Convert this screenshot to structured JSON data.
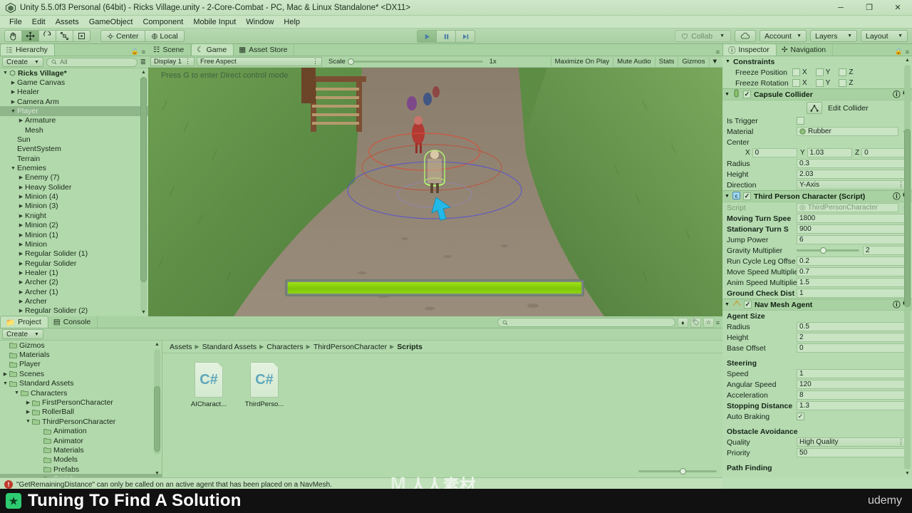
{
  "window": {
    "title": "Unity 5.5.0f3 Personal (64bit) - Ricks Village.unity - 2-Core-Combat - PC, Mac & Linux Standalone* <DX11>",
    "minimize": "─",
    "maximize": "❐",
    "close": "✕"
  },
  "menu": [
    "File",
    "Edit",
    "Assets",
    "GameObject",
    "Component",
    "Mobile Input",
    "Window",
    "Help"
  ],
  "toolbar": {
    "tools": [
      "hand-tool",
      "move-tool",
      "rotate-tool",
      "scale-tool",
      "rect-tool"
    ],
    "pivot": "Center",
    "space": "Local",
    "play": "▶",
    "pause": "❚❚",
    "step": "▶|",
    "collab": "Collab",
    "cloud": "cloud-icon",
    "account": "Account",
    "layers": "Layers",
    "layout": "Layout"
  },
  "hierarchy": {
    "tab": "Hierarchy",
    "create": "Create",
    "search_placeholder": "All",
    "root": "Ricks Village*",
    "items": [
      {
        "label": "Game Canvas",
        "depth": 1,
        "arrow": "▶"
      },
      {
        "label": "Healer",
        "depth": 1,
        "arrow": "▶"
      },
      {
        "label": "Camera Arm",
        "depth": 1,
        "arrow": "▶"
      },
      {
        "label": "Player",
        "depth": 1,
        "arrow": "▼",
        "selected": true
      },
      {
        "label": "Armature",
        "depth": 2,
        "arrow": "▶"
      },
      {
        "label": "Mesh",
        "depth": 2,
        "arrow": ""
      },
      {
        "label": "Sun",
        "depth": 1,
        "arrow": ""
      },
      {
        "label": "EventSystem",
        "depth": 1,
        "arrow": ""
      },
      {
        "label": "Terrain",
        "depth": 1,
        "arrow": ""
      },
      {
        "label": "Enemies",
        "depth": 1,
        "arrow": "▼"
      },
      {
        "label": "Enemy (7)",
        "depth": 2,
        "arrow": "▶"
      },
      {
        "label": "Heavy Solider",
        "depth": 2,
        "arrow": "▶"
      },
      {
        "label": "Minion (4)",
        "depth": 2,
        "arrow": "▶"
      },
      {
        "label": "Minion (3)",
        "depth": 2,
        "arrow": "▶"
      },
      {
        "label": "Knight",
        "depth": 2,
        "arrow": "▶"
      },
      {
        "label": "Minion (2)",
        "depth": 2,
        "arrow": "▶"
      },
      {
        "label": "Minion (1)",
        "depth": 2,
        "arrow": "▶"
      },
      {
        "label": "Minion",
        "depth": 2,
        "arrow": "▶"
      },
      {
        "label": "Regular Solider (1)",
        "depth": 2,
        "arrow": "▶"
      },
      {
        "label": "Regular Solider",
        "depth": 2,
        "arrow": "▶"
      },
      {
        "label": "Healer (1)",
        "depth": 2,
        "arrow": "▶"
      },
      {
        "label": "Archer (2)",
        "depth": 2,
        "arrow": "▶"
      },
      {
        "label": "Archer (1)",
        "depth": 2,
        "arrow": "▶"
      },
      {
        "label": "Archer",
        "depth": 2,
        "arrow": "▶"
      },
      {
        "label": "Regular Solider (2)",
        "depth": 2,
        "arrow": "▶"
      }
    ]
  },
  "gameview": {
    "tabs": [
      {
        "label": "Scene",
        "icon": "scene-icon",
        "active": false
      },
      {
        "label": "Game",
        "icon": "game-icon",
        "active": true
      },
      {
        "label": "Asset Store",
        "icon": "store-icon",
        "active": false
      }
    ],
    "display": "Display 1",
    "aspect": "Free Aspect",
    "scale_label": "Scale",
    "scale_value": "1x",
    "maximize_on_play": "Maximize On Play",
    "mute_audio": "Mute Audio",
    "stats": "Stats",
    "gizmos": "Gizmos",
    "hint": "Press G to enter Direct control mode",
    "health_percent": "100"
  },
  "inspector": {
    "tabs": [
      {
        "label": "Inspector",
        "icon": "inspector-icon",
        "active": true
      },
      {
        "label": "Navigation",
        "icon": "navigation-icon",
        "active": false
      }
    ],
    "constraints": {
      "title": "Constraints",
      "freeze_position_label": "Freeze Position",
      "freeze_rotation_label": "Freeze Rotation",
      "axes": [
        "X",
        "Y",
        "Z"
      ]
    },
    "capsule_collider": {
      "title": "Capsule Collider",
      "enabled": true,
      "edit_collider": "Edit Collider",
      "rows": [
        {
          "label": "Is Trigger",
          "type": "checkbox",
          "value": false
        },
        {
          "label": "Material",
          "type": "object",
          "value": "Rubber"
        },
        {
          "label": "Center",
          "type": "header"
        },
        {
          "label": "",
          "type": "vector3",
          "x": "0",
          "y": "1.03",
          "z": "0"
        },
        {
          "label": "Radius",
          "type": "text",
          "value": "0.3"
        },
        {
          "label": "Height",
          "type": "text",
          "value": "2.03"
        },
        {
          "label": "Direction",
          "type": "combo",
          "value": "Y-Axis"
        }
      ]
    },
    "third_person": {
      "title": "Third Person Character (Script)",
      "enabled": true,
      "rows": [
        {
          "label": "Script",
          "type": "object",
          "value": "ThirdPersonCharacter",
          "dim": true
        },
        {
          "label": "Moving Turn Spee",
          "type": "text",
          "value": "1800",
          "bold": true
        },
        {
          "label": "Stationary Turn S",
          "type": "text",
          "value": "900",
          "bold": true
        },
        {
          "label": "Jump Power",
          "type": "text",
          "value": "6"
        },
        {
          "label": "Gravity Multiplier",
          "type": "slider",
          "value": "2",
          "knob_pct": 38
        },
        {
          "label": "Run Cycle Leg Offse",
          "type": "text",
          "value": "0.2"
        },
        {
          "label": "Move Speed Multiplie",
          "type": "text",
          "value": "0.7"
        },
        {
          "label": "Anim Speed Multiplie",
          "type": "text",
          "value": "1.5"
        },
        {
          "label": "Ground Check Dist",
          "type": "text",
          "value": "1",
          "bold": true
        }
      ]
    },
    "nav_mesh_agent": {
      "title": "Nav Mesh Agent",
      "enabled": true,
      "groups": [
        {
          "header": "Agent Size",
          "rows": [
            {
              "label": "Radius",
              "type": "text",
              "value": "0.5"
            },
            {
              "label": "Height",
              "type": "text",
              "value": "2"
            },
            {
              "label": "Base Offset",
              "type": "text",
              "value": "0"
            }
          ]
        },
        {
          "header": "Steering",
          "rows": [
            {
              "label": "Speed",
              "type": "text",
              "value": "1"
            },
            {
              "label": "Angular Speed",
              "type": "text",
              "value": "120"
            },
            {
              "label": "Acceleration",
              "type": "text",
              "value": "8"
            },
            {
              "label": "Stopping Distance",
              "type": "text",
              "value": "1.3",
              "bold": true
            },
            {
              "label": "Auto Braking",
              "type": "checkbox",
              "value": true
            }
          ]
        },
        {
          "header": "Obstacle Avoidance",
          "rows": [
            {
              "label": "Quality",
              "type": "combo",
              "value": "High Quality"
            },
            {
              "label": "Priority",
              "type": "text",
              "value": "50"
            }
          ]
        },
        {
          "header": "Path Finding",
          "rows": []
        }
      ]
    }
  },
  "project": {
    "tabs": [
      {
        "label": "Project",
        "icon": "folder-icon",
        "active": true
      },
      {
        "label": "Console",
        "icon": "console-icon",
        "active": false
      }
    ],
    "create": "Create",
    "search_placeholder": "",
    "tree": [
      {
        "label": "Gizmos",
        "depth": 1,
        "arrow": "",
        "cut": true
      },
      {
        "label": "Materials",
        "depth": 1,
        "arrow": ""
      },
      {
        "label": "Player",
        "depth": 1,
        "arrow": ""
      },
      {
        "label": "Scenes",
        "depth": 1,
        "arrow": "▶"
      },
      {
        "label": "Standard Assets",
        "depth": 1,
        "arrow": "▼"
      },
      {
        "label": "Characters",
        "depth": 2,
        "arrow": "▼"
      },
      {
        "label": "FirstPersonCharacter",
        "depth": 3,
        "arrow": "▶"
      },
      {
        "label": "RollerBall",
        "depth": 3,
        "arrow": "▶"
      },
      {
        "label": "ThirdPersonCharacter",
        "depth": 3,
        "arrow": "▼"
      },
      {
        "label": "Animation",
        "depth": 4,
        "arrow": ""
      },
      {
        "label": "Animator",
        "depth": 4,
        "arrow": ""
      },
      {
        "label": "Materials",
        "depth": 4,
        "arrow": ""
      },
      {
        "label": "Models",
        "depth": 4,
        "arrow": ""
      },
      {
        "label": "Prefabs",
        "depth": 4,
        "arrow": ""
      },
      {
        "label": "Scripts",
        "depth": 4,
        "arrow": "",
        "selected": true
      }
    ],
    "breadcrumbs": [
      "Assets",
      "Standard Assets",
      "Characters",
      "ThirdPersonCharacter",
      "Scripts"
    ],
    "assets": [
      {
        "name": "AICharact...",
        "type": "C#"
      },
      {
        "name": "ThirdPerso...",
        "type": "C#"
      }
    ]
  },
  "status": {
    "message": "\"GetRemainingDistance\" can only be called on an active agent that has been placed on a NavMesh.",
    "icon": "error-icon"
  },
  "banner": {
    "title": "Tuning To Find A Solution",
    "icon": "course-icon",
    "brand": "udemy"
  },
  "watermark": {
    "logo": "M",
    "text": "人人素材"
  },
  "colors": {
    "accent_green": "#8ab384",
    "panel": "#b2d9ac",
    "health": "#8fd40f",
    "error": "#c0392b",
    "banner_bg": "#111111"
  }
}
